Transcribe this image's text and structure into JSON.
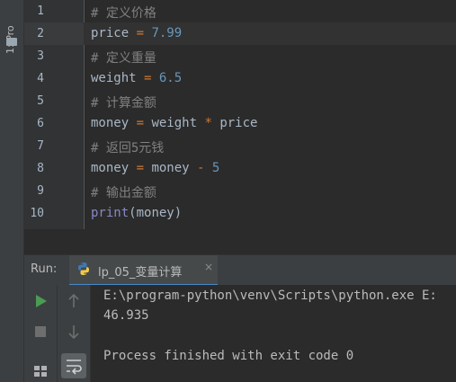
{
  "sidebar": {
    "project_tab_label": "1: Pro"
  },
  "editor": {
    "current_line": 2,
    "lines": [
      {
        "num": "1",
        "tokens": [
          {
            "t": "# 定义价格",
            "c": "cmt"
          }
        ]
      },
      {
        "num": "2",
        "tokens": [
          {
            "t": "price ",
            "c": ""
          },
          {
            "t": "=",
            "c": "op"
          },
          {
            "t": " 7.99",
            "c": "num"
          }
        ]
      },
      {
        "num": "3",
        "tokens": [
          {
            "t": "# 定义重量",
            "c": "cmt"
          }
        ]
      },
      {
        "num": "4",
        "tokens": [
          {
            "t": "weight ",
            "c": ""
          },
          {
            "t": "=",
            "c": "op"
          },
          {
            "t": " 6.5",
            "c": "num"
          }
        ]
      },
      {
        "num": "5",
        "tokens": [
          {
            "t": "# 计算金额",
            "c": "cmt"
          }
        ]
      },
      {
        "num": "6",
        "tokens": [
          {
            "t": "money ",
            "c": ""
          },
          {
            "t": "=",
            "c": "op"
          },
          {
            "t": " weight ",
            "c": ""
          },
          {
            "t": "*",
            "c": "op"
          },
          {
            "t": " price",
            "c": ""
          }
        ]
      },
      {
        "num": "7",
        "tokens": [
          {
            "t": "# 返回5元钱",
            "c": "cmt"
          }
        ]
      },
      {
        "num": "8",
        "tokens": [
          {
            "t": "money ",
            "c": ""
          },
          {
            "t": "=",
            "c": "op"
          },
          {
            "t": " money ",
            "c": ""
          },
          {
            "t": "-",
            "c": "op"
          },
          {
            "t": " 5",
            "c": "num"
          }
        ]
      },
      {
        "num": "9",
        "tokens": [
          {
            "t": "# 输出金额",
            "c": "cmt"
          }
        ]
      },
      {
        "num": "10",
        "tokens": [
          {
            "t": "print",
            "c": "fn"
          },
          {
            "t": "(money)",
            "c": ""
          }
        ]
      }
    ]
  },
  "run": {
    "label": "Run:",
    "tab_label": "lp_05_变量计算",
    "tab_close": "×",
    "console_lines": [
      "E:\\program-python\\venv\\Scripts\\python.exe E:",
      "46.935",
      "",
      "Process finished with exit code 0"
    ]
  },
  "icons": {
    "run": "play-icon",
    "stop": "stop-icon",
    "up": "arrow-up-icon",
    "down": "arrow-down-icon",
    "layout": "layout-icon",
    "wrap": "soft-wrap-icon"
  },
  "colors": {
    "run_green": "#499c54",
    "tab_underline": "#4a88c7"
  }
}
